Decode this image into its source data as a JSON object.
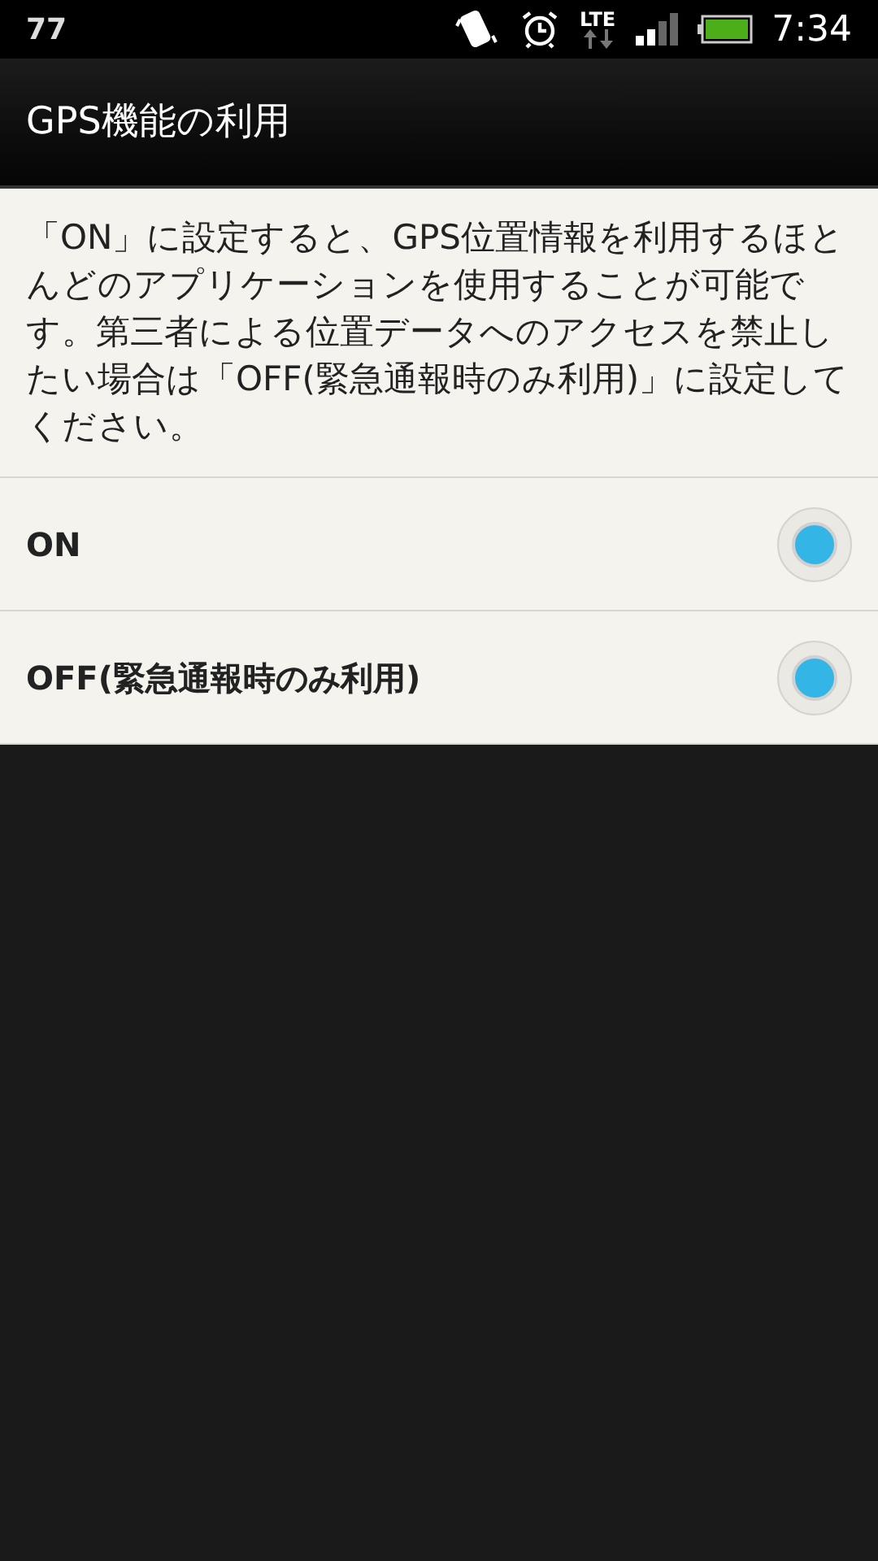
{
  "status_bar": {
    "notification": "77",
    "network": "LTE",
    "time": "7:34"
  },
  "title": "GPS機能の利用",
  "description": "「ON」に設定すると、GPS位置情報を利用するほとんどのアプリケーションを使用することが可能です。第三者による位置データへのアクセスを禁止したい場合は「OFF(緊急通報時のみ利用)」に設定してください。",
  "options": [
    {
      "label": "ON",
      "selected": true
    },
    {
      "label": "OFF(緊急通報時のみ利用)",
      "selected": true
    }
  ]
}
